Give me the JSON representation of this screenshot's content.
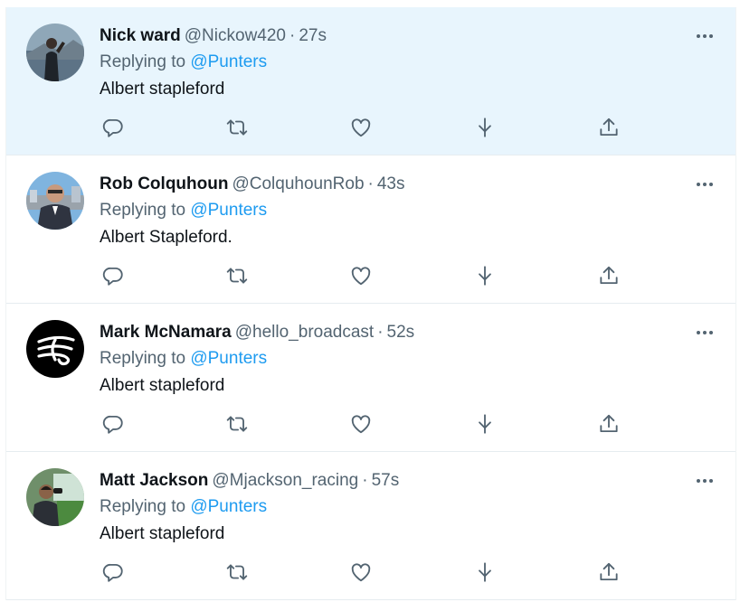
{
  "tweets": [
    {
      "name": "Nick ward",
      "handle": "@Nickow420",
      "separator": "·",
      "time": "27s",
      "replying_prefix": "Replying to",
      "replying_to": "@Punters",
      "text": "Albert stapleford",
      "highlighted": true
    },
    {
      "name": "Rob Colquhoun",
      "handle": "@ColquhounRob",
      "separator": "·",
      "time": "43s",
      "replying_prefix": "Replying to",
      "replying_to": "@Punters",
      "text": "Albert Stapleford.",
      "highlighted": false
    },
    {
      "name": "Mark McNamara",
      "handle": "@hello_broadcast",
      "separator": "·",
      "time": "52s",
      "replying_prefix": "Replying to",
      "replying_to": "@Punters",
      "text": "Albert stapleford",
      "highlighted": false
    },
    {
      "name": "Matt Jackson",
      "handle": "@Mjackson_racing",
      "separator": "·",
      "time": "57s",
      "replying_prefix": "Replying to",
      "replying_to": "@Punters",
      "text": "Albert stapleford",
      "highlighted": false
    }
  ],
  "icons": {
    "more": "more-horizontal-icon",
    "reply": "reply-icon",
    "retweet": "retweet-icon",
    "like": "heart-icon",
    "download": "download-icon",
    "share": "share-icon"
  },
  "colors": {
    "highlight_bg": "#e8f5fd",
    "mention": "#1d9bf0",
    "secondary_text": "#536471",
    "primary_text": "#0f1419"
  }
}
